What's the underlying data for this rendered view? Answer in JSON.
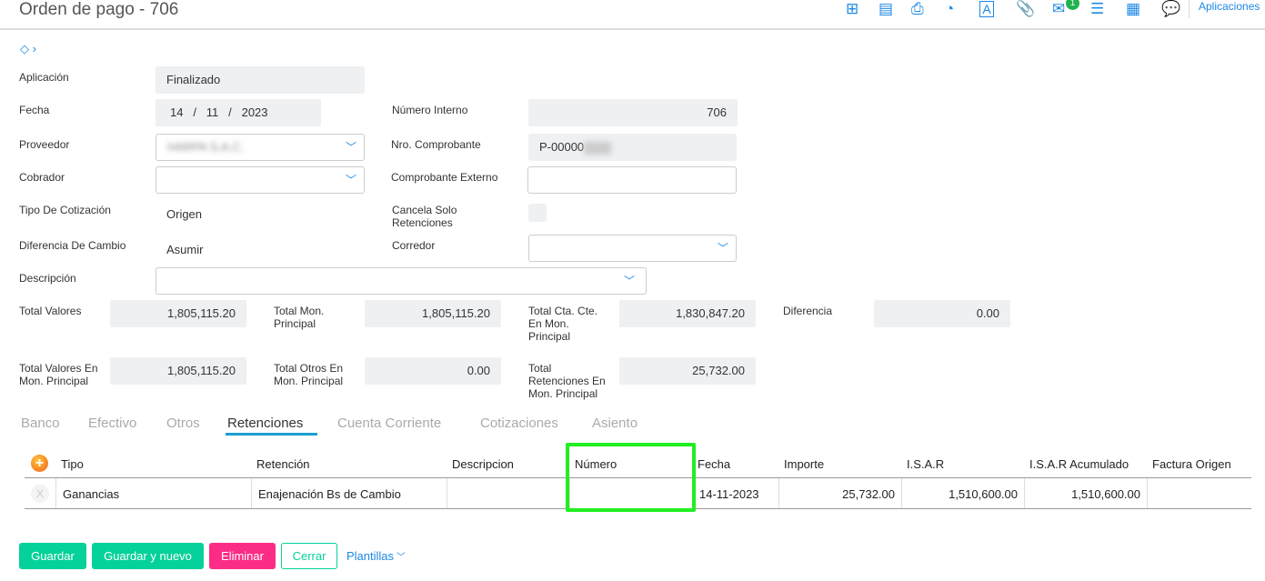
{
  "header": {
    "title": "Orden de pago - 706",
    "apps_label": "Aplicaciones",
    "mail_badge": "1"
  },
  "form": {
    "aplicacion_label": "Aplicación",
    "aplicacion_value": "Finalizado",
    "fecha_label": "Fecha",
    "fecha_day": "14",
    "fecha_month": "11",
    "fecha_year": "2023",
    "fecha_sep": "/",
    "numero_interno_label": "Número Interno",
    "numero_interno_value": "706",
    "proveedor_label": "Proveedor",
    "proveedor_value": "HARPA S.A.C.",
    "nro_comprobante_label": "Nro. Comprobante",
    "nro_comprobante_value": "P-00000",
    "cobrador_label": "Cobrador",
    "comprobante_externo_label": "Comprobante Externo",
    "tipo_cotizacion_label": "Tipo De Cotización",
    "tipo_cotizacion_value": "Origen",
    "cancela_label": "Cancela Solo Retenciones",
    "diferencia_cambio_label": "Diferencia De Cambio",
    "diferencia_cambio_value": "Asumir",
    "corredor_label": "Corredor",
    "descripcion_label": "Descripción"
  },
  "totals": [
    {
      "label": "Total Valores",
      "value": "1,805,115.20"
    },
    {
      "label": "Total Mon. Principal",
      "value": "1,805,115.20"
    },
    {
      "label": "Total Cta. Cte. En Mon. Principal",
      "value": "1,830,847.20"
    },
    {
      "label": "Diferencia",
      "value": "0.00"
    },
    {
      "label": "Total Valores En Mon. Principal",
      "value": "1,805,115.20"
    },
    {
      "label": "Total Otros En Mon. Principal",
      "value": "0.00"
    },
    {
      "label": "Total Retenciones En Mon. Principal",
      "value": "25,732.00"
    }
  ],
  "tabs": [
    "Banco",
    "Efectivo",
    "Otros",
    "Retenciones",
    "Cuenta Corriente",
    "Cotizaciones",
    "Asiento"
  ],
  "table": {
    "headers": [
      "Tipo",
      "Retención",
      "Descripcion",
      "Número",
      "Fecha",
      "Importe",
      "I.S.A.R",
      "I.S.A.R Acumulado",
      "Factura Origen"
    ],
    "row": [
      "Ganancias",
      "Enajenación Bs de Cambio",
      "",
      "",
      "14-11-2023",
      "25,732.00",
      "1,510,600.00",
      "1,510,600.00",
      ""
    ],
    "remove": "X"
  },
  "buttons": {
    "guardar": "Guardar",
    "guardar_nuevo": "Guardar y nuevo",
    "eliminar": "Eliminar",
    "cerrar": "Cerrar",
    "plantillas": "Plantillas"
  }
}
